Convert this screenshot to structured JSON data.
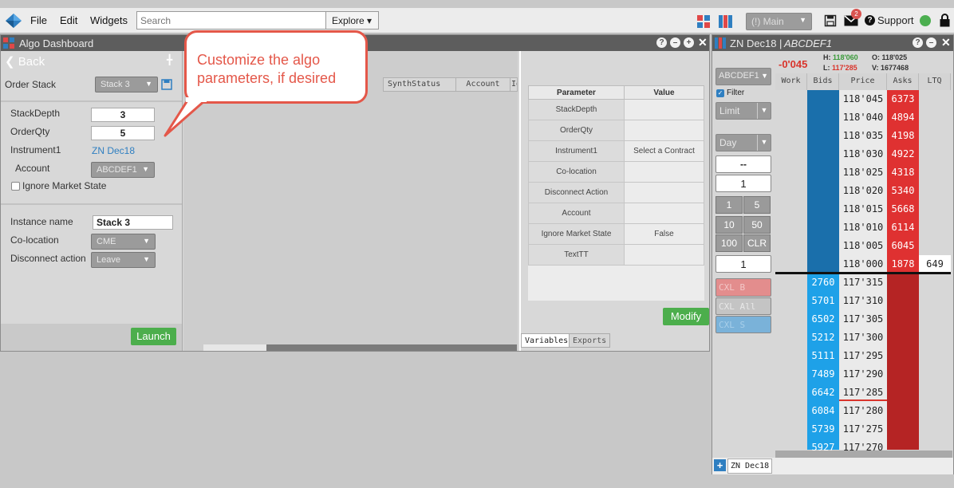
{
  "menubar": {
    "items": [
      "File",
      "Edit",
      "Widgets"
    ],
    "search_placeholder": "Search",
    "explore_label": "Explore",
    "workspace_label": "(!) Main",
    "mail_badge": "2",
    "support_label": "Support",
    "status_color": "#4caf50"
  },
  "algo_window": {
    "title": "Algo Dashboard",
    "back_label": "Back",
    "order_stack_label": "Order Stack",
    "order_stack_value": "Stack 3",
    "fields": {
      "stack_depth_label": "StackDepth",
      "stack_depth_value": "3",
      "order_qty_label": "OrderQty",
      "order_qty_value": "5",
      "instrument_label": "Instrument1",
      "instrument_value": "ZN Dec18",
      "account_label": "Account",
      "account_value": "ABCDEF1",
      "ignore_label": "Ignore Market State",
      "instance_label": "Instance name",
      "instance_value": "Stack 3",
      "colocation_label": "Co-location",
      "colocation_value": "CME",
      "disconnect_label": "Disconnect action",
      "disconnect_value": "Leave"
    },
    "launch_label": "Launch",
    "grid_columns": [
      "SynthStatus",
      "Account",
      "Id"
    ],
    "param_table": {
      "headers": [
        "Parameter",
        "Value"
      ],
      "rows": [
        {
          "name": "StackDepth",
          "value": ""
        },
        {
          "name": "OrderQty",
          "value": ""
        },
        {
          "name": "Instrument1",
          "value": "Select a Contract"
        },
        {
          "name": "Co-location",
          "value": ""
        },
        {
          "name": "Disconnect Action",
          "value": ""
        },
        {
          "name": "Account",
          "value": ""
        },
        {
          "name": "Ignore Market State",
          "value": "False"
        },
        {
          "name": "TextTT",
          "value": ""
        }
      ]
    },
    "modify_label": "Modify",
    "tabs": [
      "Variables",
      "Exports"
    ]
  },
  "callout": {
    "line1": "Customize the algo",
    "line2": "parameters, if desired"
  },
  "ladder": {
    "title": "ZN Dec18",
    "account": "ABCDEF1",
    "net_change": "-0'045",
    "high_label": "H:",
    "high_value": "118'060",
    "low_label": "L:",
    "low_value": "117'285",
    "open_label": "O:",
    "open_value": "118'025",
    "volume_label": "V:",
    "volume_value": "1677468",
    "account_dd": "ABCDEF1",
    "filter_label": "Filter",
    "order_type": "Limit",
    "tif": "Day",
    "dash": "--",
    "qty": "1",
    "qty_buttons": [
      "1",
      "5",
      "10",
      "50",
      "100",
      "CLR"
    ],
    "qty2": "1",
    "cxl_label": "CXL B",
    "cxl_all_label": "CXL All",
    "cxl_s_label": "CXL S",
    "columns": [
      "Work",
      "Bids",
      "Price",
      "Asks",
      "LTQ"
    ],
    "ask_rows": [
      {
        "price": "118'045",
        "ask": "6373"
      },
      {
        "price": "118'040",
        "ask": "4894"
      },
      {
        "price": "118'035",
        "ask": "4198"
      },
      {
        "price": "118'030",
        "ask": "4922"
      },
      {
        "price": "118'025",
        "ask": "4318"
      },
      {
        "price": "118'020",
        "ask": "5340"
      },
      {
        "price": "118'015",
        "ask": "5668"
      },
      {
        "price": "118'010",
        "ask": "6114"
      },
      {
        "price": "118'005",
        "ask": "6045"
      },
      {
        "price": "118'000",
        "ask": "1878",
        "ltq": "649"
      }
    ],
    "bid_rows": [
      {
        "price": "117'315",
        "bid": "2760"
      },
      {
        "price": "117'310",
        "bid": "5701"
      },
      {
        "price": "117'305",
        "bid": "6502"
      },
      {
        "price": "117'300",
        "bid": "5212"
      },
      {
        "price": "117'295",
        "bid": "5111"
      },
      {
        "price": "117'290",
        "bid": "7489"
      },
      {
        "price": "117'285",
        "bid": "6642"
      },
      {
        "price": "117'280",
        "bid": "6084"
      },
      {
        "price": "117'275",
        "bid": "5739"
      },
      {
        "price": "117'270",
        "bid": "5927"
      }
    ],
    "bottom_tab": "ZN Dec18"
  }
}
